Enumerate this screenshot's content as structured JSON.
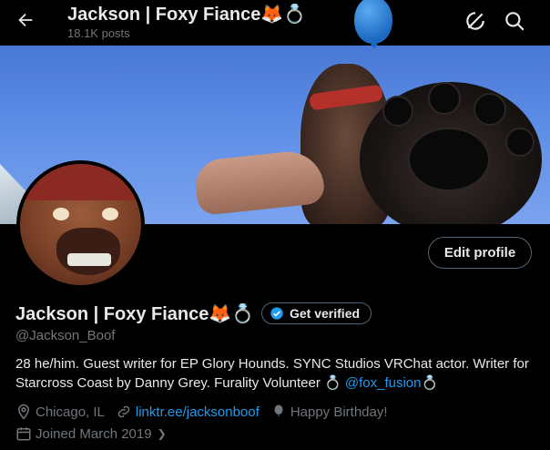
{
  "header": {
    "back_label": "←",
    "title": "Jackson | Foxy Fiance🦊💍",
    "posts": "18.1K posts",
    "icons": [
      "back-arrow-icon",
      "notification-off-icon",
      "search-icon"
    ]
  },
  "profile": {
    "display_name": "Jackson | Foxy Fiance🦊💍",
    "verify_label": "Get verified",
    "handle": "@Jackson_Boof",
    "edit_label": "Edit profile",
    "bio_text": "28 he/him. Guest writer for EP Glory Hounds. SYNC Studios VRChat actor. Writer for Starcross Coast by Danny Grey. Furality Volunteer 💍 ",
    "bio_link": "@fox_fusion",
    "bio_suffix": "💍",
    "location": "Chicago, IL",
    "website": "linktr.ee/jacksonboof",
    "birthday": "Happy Birthday!",
    "joined": "Joined March 2019",
    "joined_chevron": "❯"
  },
  "colors": {
    "accent": "#1d9bf0",
    "muted": "#71767b",
    "text": "#e7e9ea",
    "background": "#000000"
  }
}
